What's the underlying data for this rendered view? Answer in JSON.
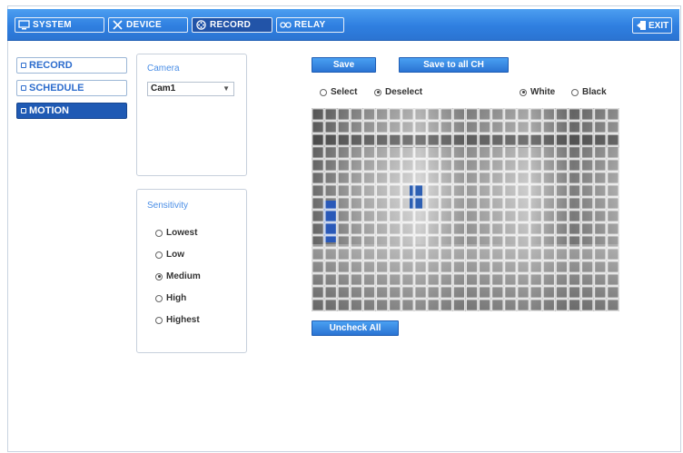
{
  "topbar": {
    "tabs": [
      {
        "label": "SYSTEM",
        "icon": "monitor-icon",
        "active": false
      },
      {
        "label": "DEVICE",
        "icon": "tools-icon",
        "active": false
      },
      {
        "label": "RECORD",
        "icon": "film-reel-icon",
        "active": true
      },
      {
        "label": "RELAY",
        "icon": "relay-icon",
        "active": false
      }
    ],
    "exit_label": "EXIT",
    "exit_icon": "exit-door-icon"
  },
  "sidebar": {
    "items": [
      {
        "label": "RECORD",
        "active": false
      },
      {
        "label": "SCHEDULE",
        "active": false
      },
      {
        "label": "MOTION",
        "active": true
      }
    ]
  },
  "camera_panel": {
    "title": "Camera",
    "selected": "Cam1"
  },
  "sensitivity_panel": {
    "title": "Sensitivity",
    "options": [
      "Lowest",
      "Low",
      "Medium",
      "High",
      "Highest"
    ],
    "selected": "Medium"
  },
  "actions": {
    "save_label": "Save",
    "save_all_label": "Save to all CH",
    "uncheck_all_label": "Uncheck All"
  },
  "mode_options": {
    "select_label": "Select",
    "deselect_label": "Deselect",
    "mode_selected": "Deselect",
    "white_label": "White",
    "black_label": "Black",
    "color_selected": "White"
  },
  "colors": {
    "accent": "#2f7fe0",
    "active_tab": "#2254a8",
    "sidebar_text": "#2c6ccd"
  }
}
